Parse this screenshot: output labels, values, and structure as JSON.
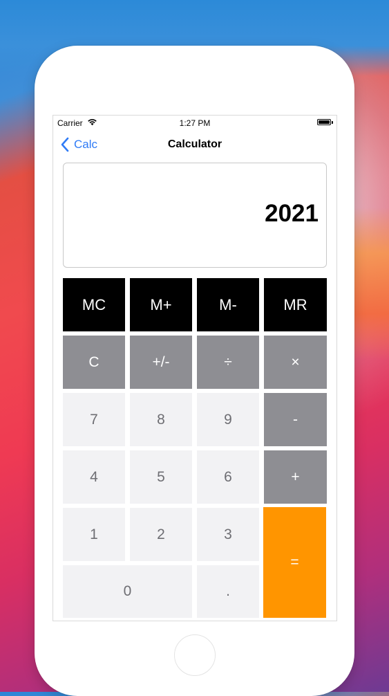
{
  "status_bar": {
    "carrier": "Carrier",
    "time": "1:27 PM"
  },
  "nav": {
    "back_label": "Calc",
    "title": "Calculator"
  },
  "display": {
    "value": "2021"
  },
  "keys": {
    "mc": "MC",
    "m_plus": "M+",
    "m_minus": "M-",
    "mr": "MR",
    "clear": "C",
    "sign": "+/-",
    "divide": "÷",
    "multiply": "×",
    "seven": "7",
    "eight": "8",
    "nine": "9",
    "minus": "-",
    "four": "4",
    "five": "5",
    "six": "6",
    "plus": "+",
    "one": "1",
    "two": "2",
    "three": "3",
    "equals": "=",
    "zero": "0",
    "decimal": "."
  },
  "icons": [
    "wifi-icon",
    "battery-icon",
    "back-chevron-icon"
  ],
  "colors": {
    "accent": "#2f7bf6",
    "memory_key": "#000000",
    "function_key": "#8e8e93",
    "number_key": "#f2f2f4",
    "equals_key": "#ff9500"
  }
}
